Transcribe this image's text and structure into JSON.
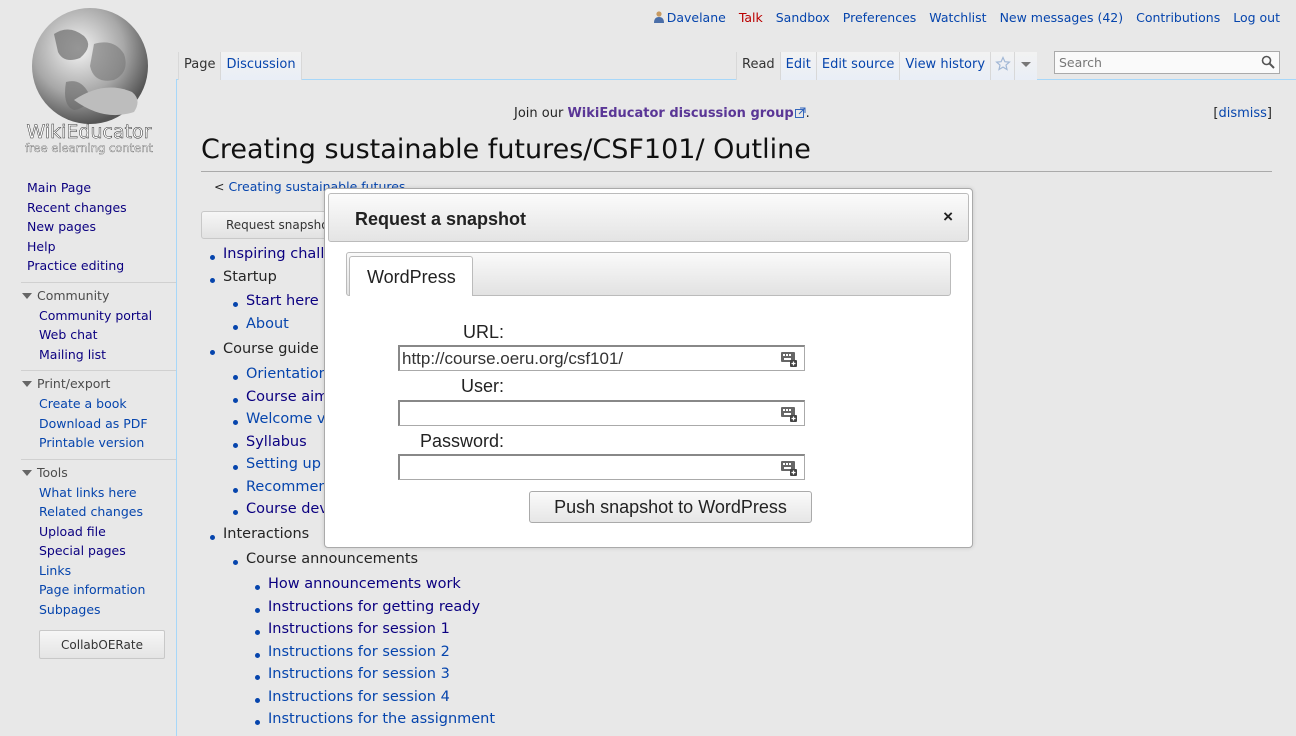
{
  "logo": {
    "wordmark": "WikiEducator",
    "tagline": "free elearning content"
  },
  "personal_tools": {
    "username": "Davelane",
    "talk": "Talk",
    "sandbox": "Sandbox",
    "preferences": "Preferences",
    "watchlist": "Watchlist",
    "messages": "New messages (42)",
    "contributions": "Contributions",
    "logout": "Log out"
  },
  "tabs": {
    "page": "Page",
    "discussion": "Discussion",
    "read": "Read",
    "edit": "Edit",
    "edit_source": "Edit source",
    "view_history": "View history"
  },
  "search": {
    "placeholder": "Search"
  },
  "sitenotice": {
    "prefix": "Join our ",
    "link": "WikiEducator discussion group",
    "suffix": ".",
    "dismiss": "dismiss"
  },
  "page": {
    "title": "Creating sustainable futures/CSF101/ Outline",
    "breadcrumb_prefix": "< ",
    "breadcrumb": "Creating sustainable futures",
    "request_snapshot_button": "Request snapshot"
  },
  "outline": {
    "level1": [
      "Inspiring challe",
      "Startup"
    ],
    "startup_items": [
      "Start here",
      "About"
    ],
    "course_guide": "Course guide",
    "course_guide_items": [
      "Orientation",
      "Course aim",
      "Welcome v",
      "Syllabus",
      "Setting up y",
      "Recommen",
      "Course dev"
    ],
    "interactions": "Interactions",
    "course_announcements": "Course announcements",
    "announcement_items": [
      "How announcements work",
      "Instructions for getting ready",
      "Instructions for session 1",
      "Instructions for session 2",
      "Instructions for session 3",
      "Instructions for session 4",
      "Instructions for the assignment"
    ]
  },
  "sidebar": {
    "nav": [
      "Main Page",
      "Recent changes",
      "New pages",
      "Help",
      "Practice editing"
    ],
    "community": {
      "heading": "Community",
      "items": [
        "Community portal",
        "Web chat",
        "Mailing list"
      ]
    },
    "print_export": {
      "heading": "Print/export",
      "items": [
        "Create a book",
        "Download as PDF",
        "Printable version"
      ]
    },
    "tools": {
      "heading": "Tools",
      "items": [
        "What links here",
        "Related changes",
        "Upload file",
        "Special pages",
        "Links",
        "Page information",
        "Subpages"
      ]
    },
    "collab_button": "CollabOERate"
  },
  "modal": {
    "title": "Request a snapshot",
    "close": "×",
    "tab": "WordPress",
    "url_label": "URL:",
    "url_value": "http://course.oeru.org/csf101/",
    "user_label": "User:",
    "user_value": "",
    "password_label": "Password:",
    "password_value": "",
    "submit": "Push snapshot to WordPress"
  }
}
